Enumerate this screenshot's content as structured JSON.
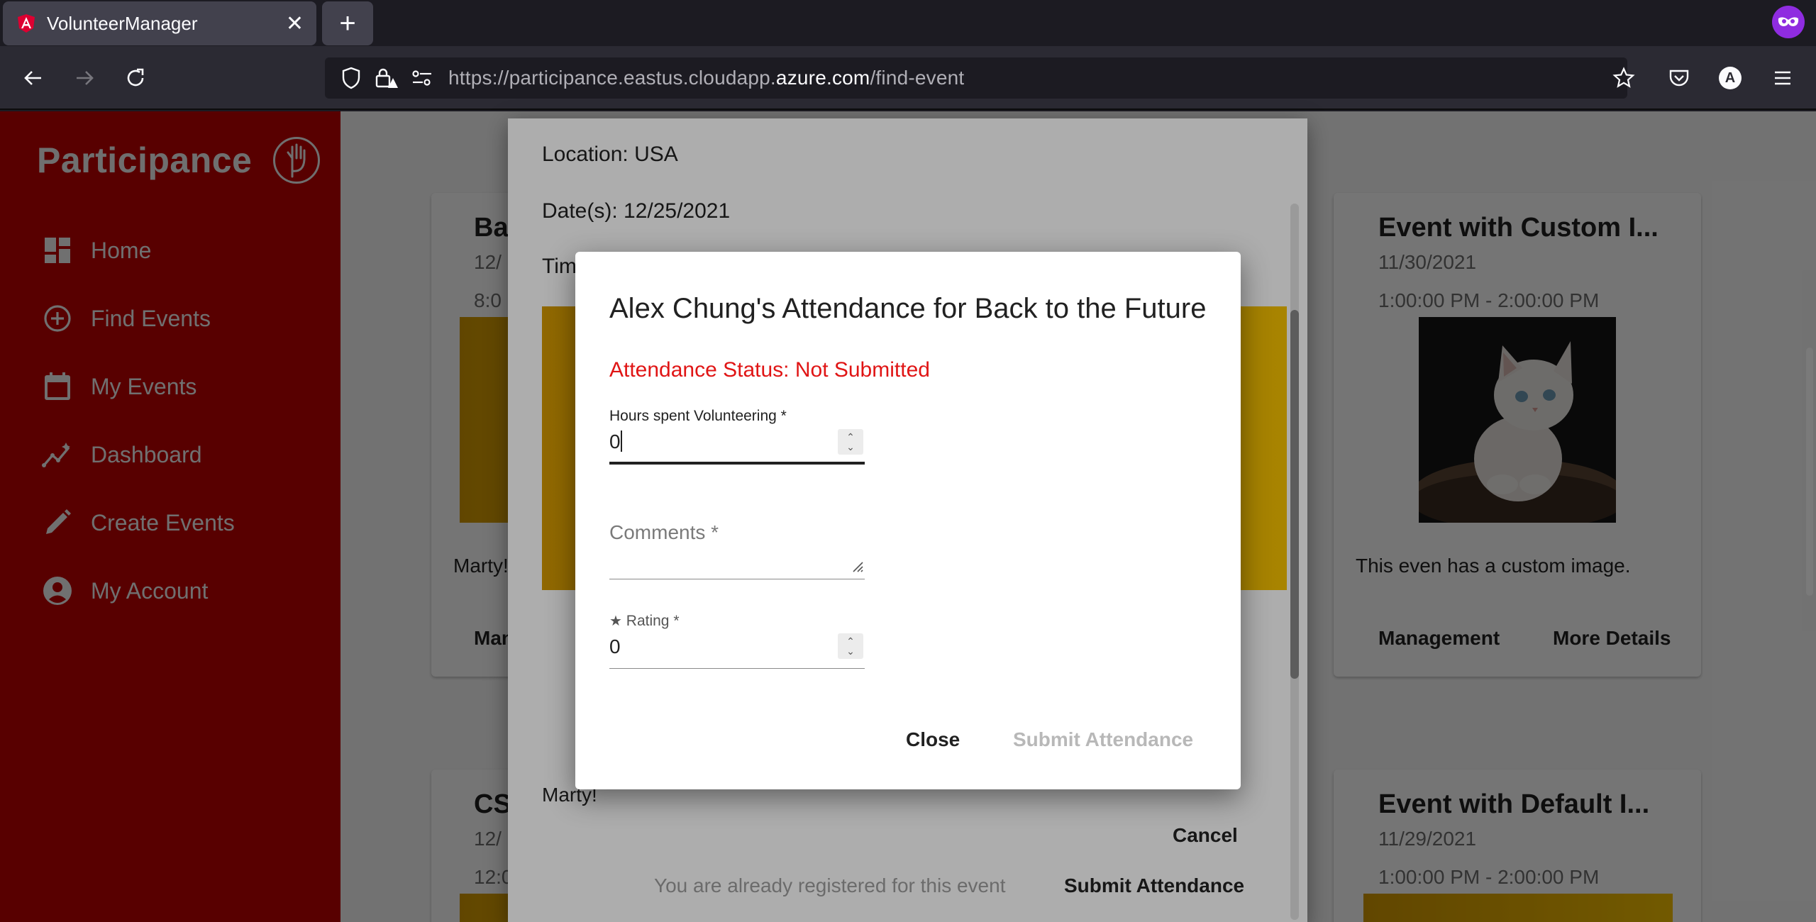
{
  "browser": {
    "tab_title": "VolunteerManager",
    "new_tab_label": "+",
    "url_prefix": "https://participance.eastus.cloudapp.",
    "url_host": "azure.com",
    "url_path": "/find-event",
    "profile_initial": "A"
  },
  "sidebar": {
    "brand": "Participance",
    "items": [
      {
        "label": "Home",
        "icon": "dashboard-icon"
      },
      {
        "label": "Find Events",
        "icon": "add-circle-icon"
      },
      {
        "label": "My Events",
        "icon": "calendar-icon"
      },
      {
        "label": "Dashboard",
        "icon": "insights-icon"
      },
      {
        "label": "Create Events",
        "icon": "pencil-icon"
      },
      {
        "label": "My Account",
        "icon": "account-circle-icon"
      }
    ]
  },
  "cards": [
    {
      "title": "Ba",
      "date": "12/",
      "time": "8:0",
      "desc": "Marty!",
      "action1": "Man"
    },
    {
      "title": "Event with Custom I...",
      "date": "11/30/2021",
      "time": "1:00:00 PM - 2:00:00 PM",
      "desc": "This even has a custom image.",
      "action1": "Management",
      "action2": "More Details"
    },
    {
      "title": "CS",
      "date": "12/",
      "time": "12:0"
    },
    {
      "title": "Event with Default I...",
      "date": "11/29/2021",
      "time": "1:00:00 PM - 2:00:00 PM"
    }
  ],
  "detail_dialog": {
    "location": "Location: USA",
    "dates": "Date(s): 12/25/2021",
    "time_partial": "Tim",
    "desc_partial": "Marty!",
    "cancel": "Cancel",
    "submit": "Submit Attendance",
    "note": "You are already registered for this event"
  },
  "attendance_dialog": {
    "title": "Alex Chung's Attendance for Back to the Future",
    "status": "Attendance Status: Not Submitted",
    "hours_label": "Hours spent Volunteering *",
    "hours_value": "0",
    "comments_placeholder": "Comments *",
    "comments_value": "",
    "rating_label": "Rating *",
    "rating_value": "0",
    "close": "Close",
    "submit": "Submit Attendance"
  },
  "colors": {
    "sidebar_bg": "#c00000",
    "status_red": "#e01515",
    "private_purple": "#8f2ce0"
  }
}
